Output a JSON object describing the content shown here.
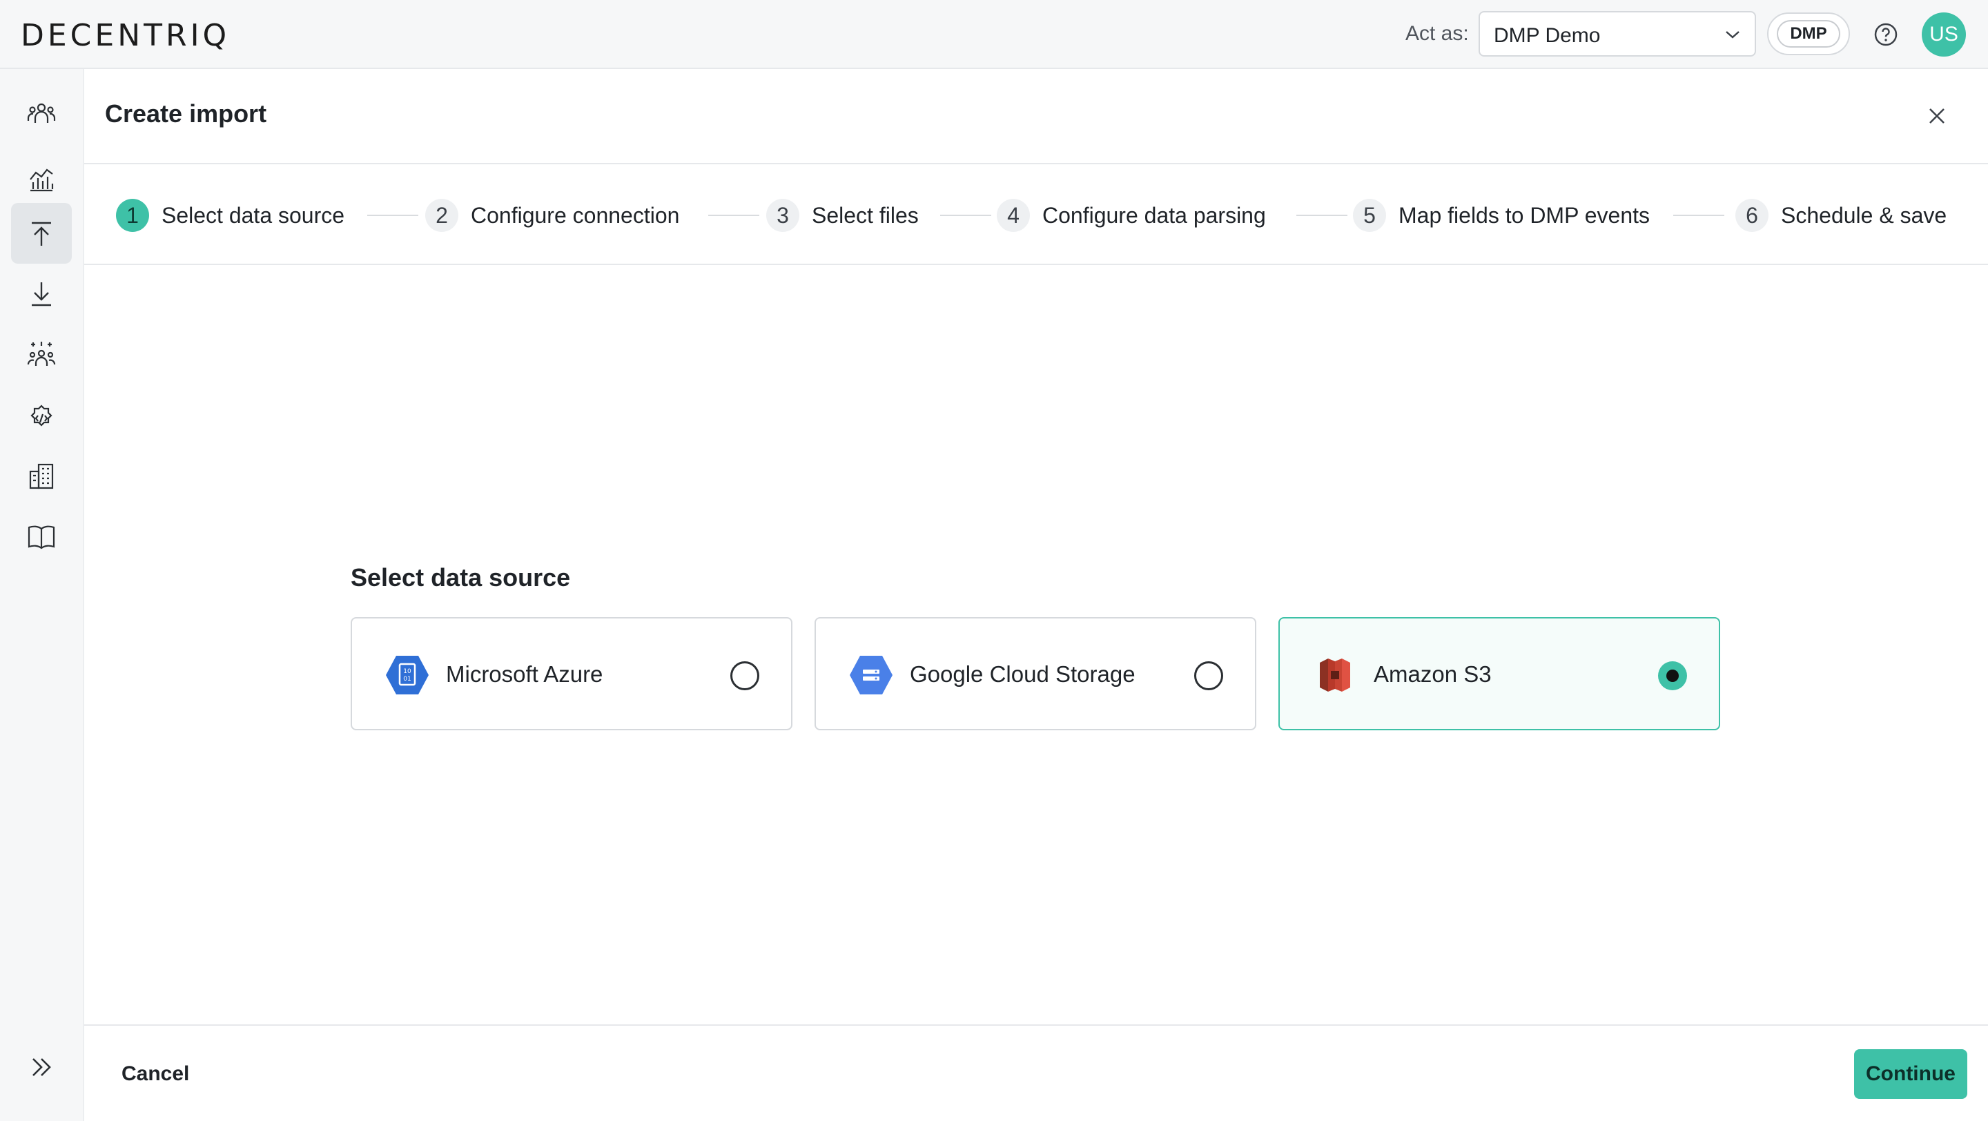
{
  "header": {
    "logo": "DECENTRIQ",
    "act_as_label": "Act as:",
    "act_as_value": "DMP Demo",
    "product_badge": "DMP",
    "avatar_initials": "US",
    "accent_color": "#3ec1a7"
  },
  "sidebar": {
    "items": [
      {
        "icon": "people-icon"
      },
      {
        "icon": "analytics-icon"
      },
      {
        "icon": "upload-icon",
        "active": true
      },
      {
        "icon": "download-icon"
      },
      {
        "icon": "audiences-icon"
      },
      {
        "icon": "developer-settings-icon"
      },
      {
        "icon": "buildings-icon"
      },
      {
        "icon": "book-icon"
      }
    ],
    "expand_icon": "double-chevron-right-icon"
  },
  "page": {
    "title": "Create import",
    "steps": [
      {
        "number": "1",
        "label": "Select data source",
        "active": true
      },
      {
        "number": "2",
        "label": "Configure connection"
      },
      {
        "number": "3",
        "label": "Select files"
      },
      {
        "number": "4",
        "label": "Configure data parsing"
      },
      {
        "number": "5",
        "label": "Map fields to DMP events"
      },
      {
        "number": "6",
        "label": "Schedule & save"
      }
    ],
    "section_title": "Select data source",
    "sources": [
      {
        "label": "Microsoft Azure",
        "icon": "azure-storage-icon",
        "selected": false
      },
      {
        "label": "Google Cloud Storage",
        "icon": "google-cloud-storage-icon",
        "selected": false
      },
      {
        "label": "Amazon S3",
        "icon": "amazon-s3-icon",
        "selected": true
      }
    ]
  },
  "footer": {
    "cancel_label": "Cancel",
    "continue_label": "Continue"
  }
}
